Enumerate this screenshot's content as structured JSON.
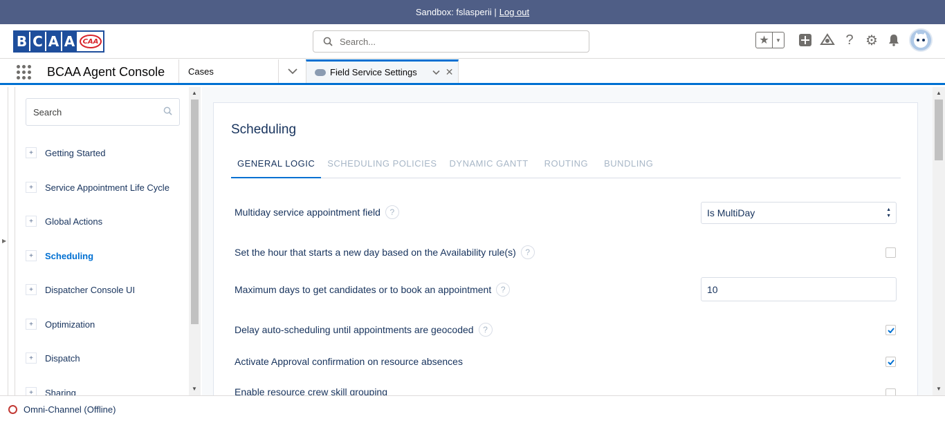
{
  "sandbox": {
    "text": "Sandbox: fslasperii |",
    "logout": "Log out"
  },
  "header": {
    "logo_letters": [
      "B",
      "C",
      "A",
      "A"
    ],
    "logo_badge": "CAA",
    "search_placeholder": "Search...",
    "icons": [
      "favorites-star-icon",
      "add-icon",
      "trailhead-icon",
      "help-icon",
      "setup-gear-icon",
      "notifications-bell-icon"
    ]
  },
  "nav": {
    "app_name": "BCAA Agent Console",
    "cases_label": "Cases",
    "tab_label": "Field Service Settings"
  },
  "sidebar": {
    "search_placeholder": "Search",
    "items": [
      {
        "label": "Getting Started",
        "active": false
      },
      {
        "label": "Service Appointment Life Cycle",
        "active": false
      },
      {
        "label": "Global Actions",
        "active": false
      },
      {
        "label": "Scheduling",
        "active": true
      },
      {
        "label": "Dispatcher Console UI",
        "active": false
      },
      {
        "label": "Optimization",
        "active": false
      },
      {
        "label": "Dispatch",
        "active": false
      },
      {
        "label": "Sharing",
        "active": false
      }
    ]
  },
  "main": {
    "title": "Scheduling",
    "tabs": [
      {
        "label": "GENERAL LOGIC",
        "active": true
      },
      {
        "label": "SCHEDULING POLICIES",
        "active": false
      },
      {
        "label": "DYNAMIC GANTT",
        "active": false
      },
      {
        "label": "ROUTING",
        "active": false
      },
      {
        "label": "BUNDLING",
        "active": false
      }
    ],
    "settings": [
      {
        "label": "Multiday service appointment field",
        "help": "?",
        "control": "select",
        "value": "Is MultiDay"
      },
      {
        "label": "Set the hour that starts a new day based on the Availability rule(s)",
        "help": "?",
        "control": "checkbox",
        "checked": false
      },
      {
        "label": "Maximum days to get candidates or to book an appointment",
        "help": "?",
        "control": "number",
        "value": "10"
      },
      {
        "label": "Delay auto-scheduling until appointments are geocoded",
        "help": "?",
        "control": "checkbox",
        "checked": true
      },
      {
        "label": "Activate Approval confirmation on resource absences",
        "control": "checkbox",
        "checked": true
      },
      {
        "label": "Enable resource crew skill grouping",
        "control": "checkbox",
        "checked": false
      }
    ]
  },
  "footer": {
    "omni_label": "Omni-Channel (Offline)",
    "status_color": "#c23934"
  },
  "colors": {
    "accent": "#0070d2",
    "sandbox_bar": "#4f5e86",
    "brand": "#1e4e9c"
  }
}
